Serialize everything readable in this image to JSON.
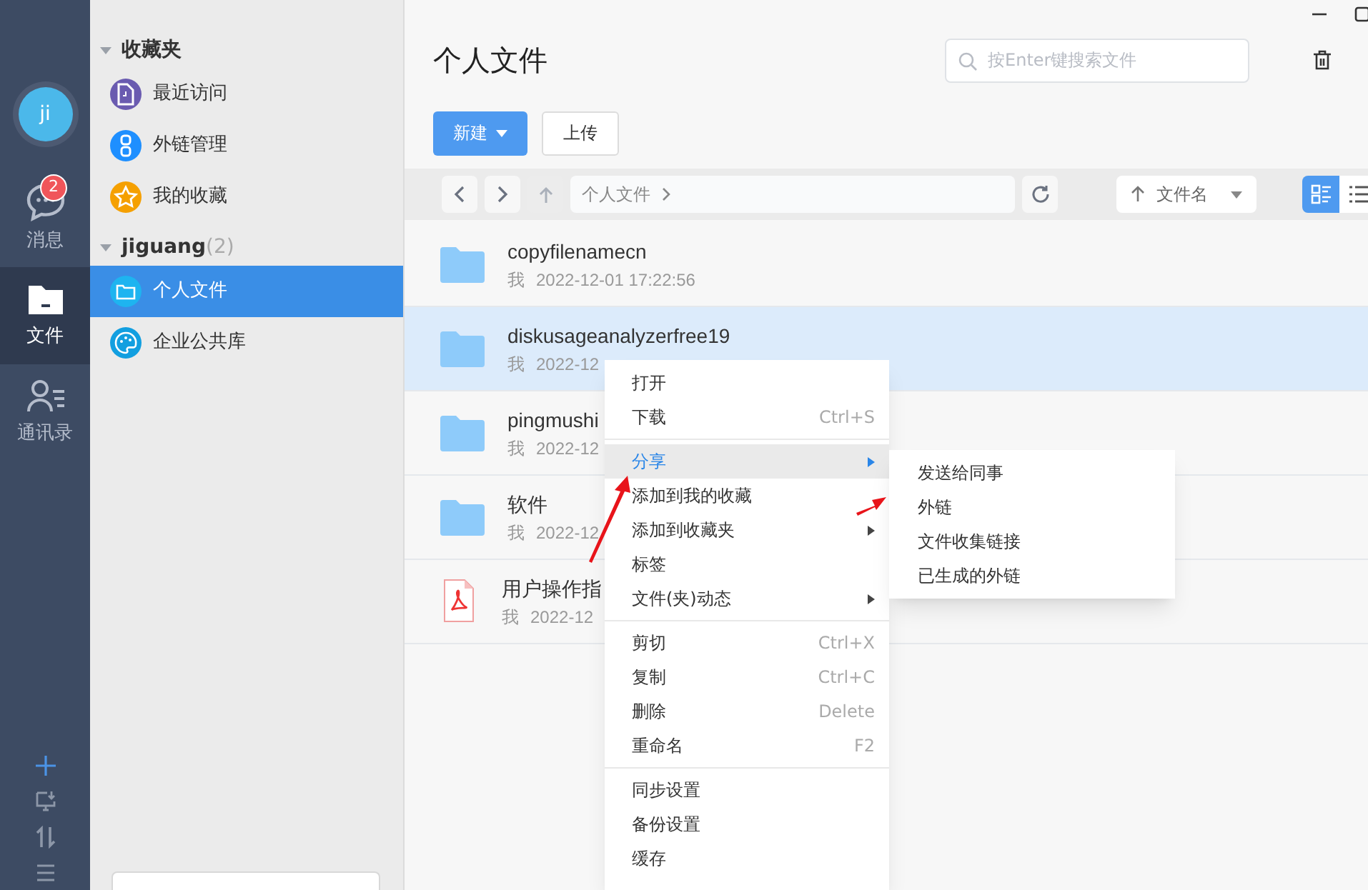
{
  "rail": {
    "avatar": "ji",
    "items": [
      {
        "label": "消息",
        "badge": "2",
        "selected": false
      },
      {
        "label": "文件",
        "selected": true
      },
      {
        "label": "通讯录",
        "selected": false
      }
    ]
  },
  "sidebar": {
    "sections": [
      {
        "title": "收藏夹",
        "expanded": true,
        "items": [
          {
            "label": "最近访问",
            "color": "#6a5bb0",
            "selected": false
          },
          {
            "label": "外链管理",
            "color": "#1e8fff",
            "selected": false
          },
          {
            "label": "我的收藏",
            "color": "#f5a000",
            "selected": false
          }
        ]
      },
      {
        "title": "jiguang",
        "count": "(2)",
        "expanded": true,
        "items": [
          {
            "label": "个人文件",
            "color": "#1eb4f0",
            "selected": true
          },
          {
            "label": "企业公共库",
            "color": "#129fe0",
            "selected": false
          }
        ]
      }
    ]
  },
  "main": {
    "title": "个人文件",
    "search": {
      "placeholder": "按Enter键搜索文件"
    },
    "buttons": [
      {
        "label": "新建",
        "kind": "primary"
      },
      {
        "label": "上传",
        "kind": "plain"
      }
    ],
    "breadcrumb": "个人文件",
    "sort": "文件名",
    "views": [
      {
        "kind": "cards",
        "selected": true
      },
      {
        "kind": "list",
        "selected": false
      }
    ],
    "files": [
      {
        "kind": "folder",
        "name": "copyfilenamecn",
        "owner": "我",
        "time": "2022-12-01 17:22:56",
        "selected": false
      },
      {
        "kind": "folder",
        "name": "diskusageanalyzerfree19",
        "owner": "我",
        "time": "2022-12",
        "selected": true
      },
      {
        "kind": "folder",
        "name": "pingmushi",
        "owner": "我",
        "time": "2022-12",
        "selected": false
      },
      {
        "kind": "folder",
        "name": "软件",
        "owner": "我",
        "time": "2022-12",
        "selected": false
      },
      {
        "kind": "pdf",
        "name": "用户操作指",
        "owner": "我",
        "time": "2022-12",
        "selected": false
      }
    ]
  },
  "context_menu": {
    "groups": [
      [
        {
          "label": "打开",
          "selected": false
        },
        {
          "label": "下载",
          "shortcut": "Ctrl+S",
          "selected": false
        }
      ],
      [
        {
          "label": "分享",
          "submenu": true,
          "selected": true
        },
        {
          "label": "添加到我的收藏",
          "selected": false
        },
        {
          "label": "添加到收藏夹",
          "submenu": true,
          "selected": false
        },
        {
          "label": "标签",
          "selected": false
        },
        {
          "label": "文件(夹)动态",
          "submenu": true,
          "selected": false
        }
      ],
      [
        {
          "label": "剪切",
          "shortcut": "Ctrl+X",
          "selected": false
        },
        {
          "label": "复制",
          "shortcut": "Ctrl+C",
          "selected": false
        },
        {
          "label": "删除",
          "shortcut": "Delete",
          "selected": false
        },
        {
          "label": "重命名",
          "shortcut": "F2",
          "selected": false
        }
      ],
      [
        {
          "label": "同步设置",
          "selected": false
        },
        {
          "label": "备份设置",
          "selected": false
        },
        {
          "label": "缓存",
          "selected": false
        }
      ]
    ],
    "submenu": [
      "发送给同事",
      "外链",
      "文件收集链接",
      "已生成的外链"
    ]
  }
}
